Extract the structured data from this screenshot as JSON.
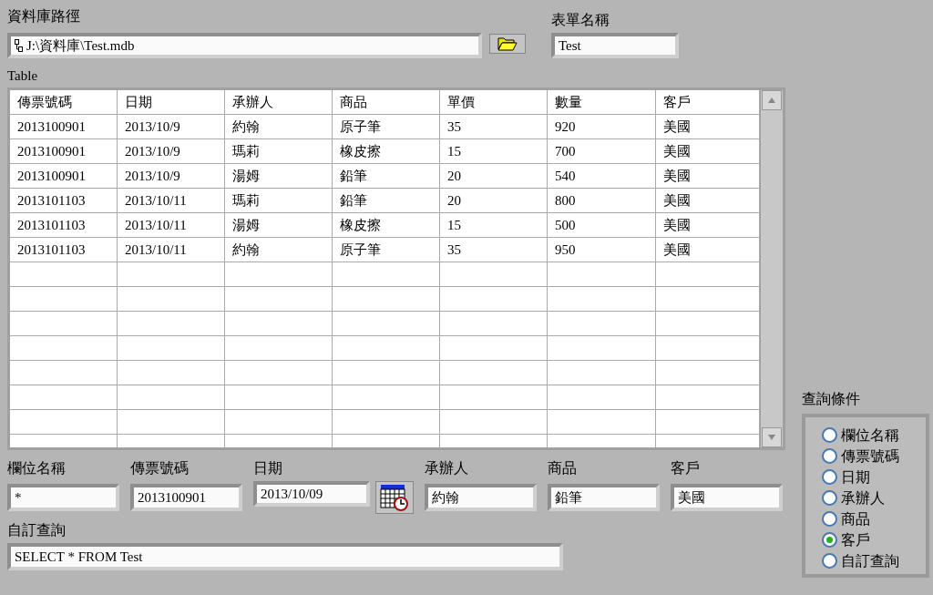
{
  "database_path": {
    "label": "資料庫路徑",
    "value": "J:\\資料庫\\Test.mdb"
  },
  "form_name": {
    "label": "表單名稱",
    "value": "Test"
  },
  "table": {
    "label": "Table",
    "columns": [
      "傳票號碼",
      "日期",
      "承辦人",
      "商品",
      "單價",
      "數量",
      "客戶"
    ],
    "rows": [
      [
        "2013100901",
        "2013/10/9",
        "約翰",
        "原子筆",
        "35",
        "920",
        "美國"
      ],
      [
        "2013100901",
        "2013/10/9",
        "瑪莉",
        "橡皮擦",
        "15",
        "700",
        "美國"
      ],
      [
        "2013100901",
        "2013/10/9",
        "湯姆",
        "鉛筆",
        "20",
        "540",
        "美國"
      ],
      [
        "2013101103",
        "2013/10/11",
        "瑪莉",
        "鉛筆",
        "20",
        "800",
        "美國"
      ],
      [
        "2013101103",
        "2013/10/11",
        "湯姆",
        "橡皮擦",
        "15",
        "500",
        "美國"
      ],
      [
        "2013101103",
        "2013/10/11",
        "約翰",
        "原子筆",
        "35",
        "950",
        "美國"
      ]
    ]
  },
  "filters": [
    {
      "kind": "text",
      "label": "欄位名稱",
      "value": "*"
    },
    {
      "kind": "text",
      "label": "傳票號碼",
      "value": "2013100901"
    },
    {
      "kind": "date",
      "label": "日期",
      "value": "2013/10/09"
    },
    {
      "kind": "text",
      "label": "承辦人",
      "value": "約翰"
    },
    {
      "kind": "text",
      "label": "商品",
      "value": "鉛筆"
    },
    {
      "kind": "text",
      "label": "客戶",
      "value": "美國"
    }
  ],
  "custom_query": {
    "label": "自訂查詢",
    "value": "SELECT * FROM Test"
  },
  "query_conditions": {
    "label": "查詢條件",
    "options": [
      {
        "label": "欄位名稱",
        "selected": false
      },
      {
        "label": "傳票號碼",
        "selected": false
      },
      {
        "label": "日期",
        "selected": false
      },
      {
        "label": "承辦人",
        "selected": false
      },
      {
        "label": "商品",
        "selected": false
      },
      {
        "label": "客戶",
        "selected": true
      },
      {
        "label": "自訂查詢",
        "selected": false
      }
    ]
  }
}
